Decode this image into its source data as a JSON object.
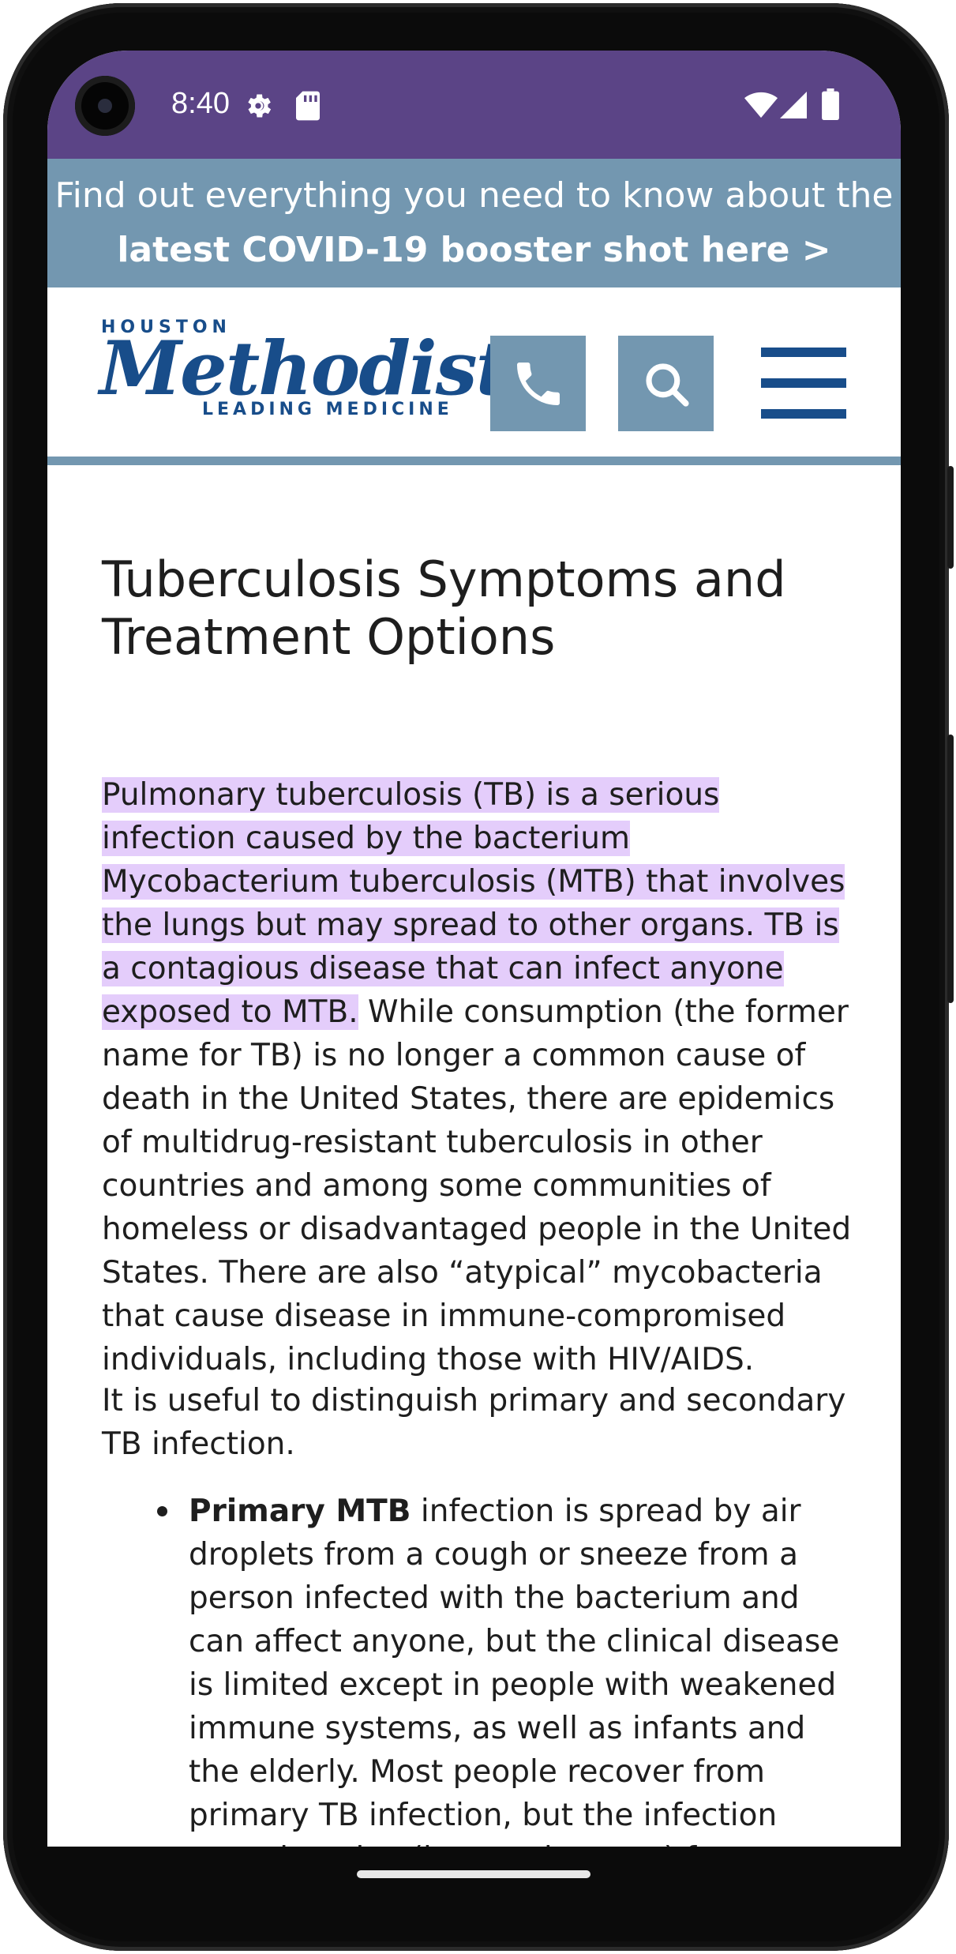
{
  "status_bar": {
    "time": "8:40",
    "icons": [
      "settings-gear-icon",
      "sd-card-icon",
      "wifi-icon",
      "cell-signal-icon",
      "battery-icon"
    ],
    "background": "#5b4486"
  },
  "banner": {
    "text_normal": "Find out everything you need to know about the ",
    "text_bold": "latest COVID-19 booster shot here >",
    "background": "#7397b0"
  },
  "header": {
    "logo": {
      "top": "HOUSTON",
      "main": "Methodist",
      "bottom": "LEADING MEDICINE"
    },
    "buttons": [
      "phone-icon",
      "search-icon",
      "menu-icon"
    ],
    "accent": "#184d8a"
  },
  "article": {
    "title": "Tuberculosis Symptoms and Treatment Options",
    "intro_highlighted": "Pulmonary tuberculosis (TB) is a serious infection caused by the bacterium Mycobacterium tuberculosis (MTB) that involves the lungs but may spread to other organs. TB is a contagious disease that can infect anyone exposed to MTB.",
    "intro_rest": " While consumption (the former name for TB) is no longer a common cause of death in the United States, there are epidemics of multidrug-resistant tuberculosis in other countries and among some communities of homeless or disadvantaged people in the United States. There are also “atypical” mycobacteria that cause disease in immune-compromised individuals, including those with HIV/AIDS.",
    "para2": "It is useful to distinguish primary and secondary TB infection.",
    "bullets": [
      {
        "bold": "Primary MTB",
        "text": " infection is spread by air droplets from a cough or sneeze from a person infected with the bacterium and can affect anyone, but the clinical disease is limited except in people with weakened immune systems, as well as infants and the elderly. Most people recover from primary TB infection, but the infection stays inactive (latent, dormant) for years."
      }
    ],
    "highlight_color": "#e4cdfb"
  }
}
